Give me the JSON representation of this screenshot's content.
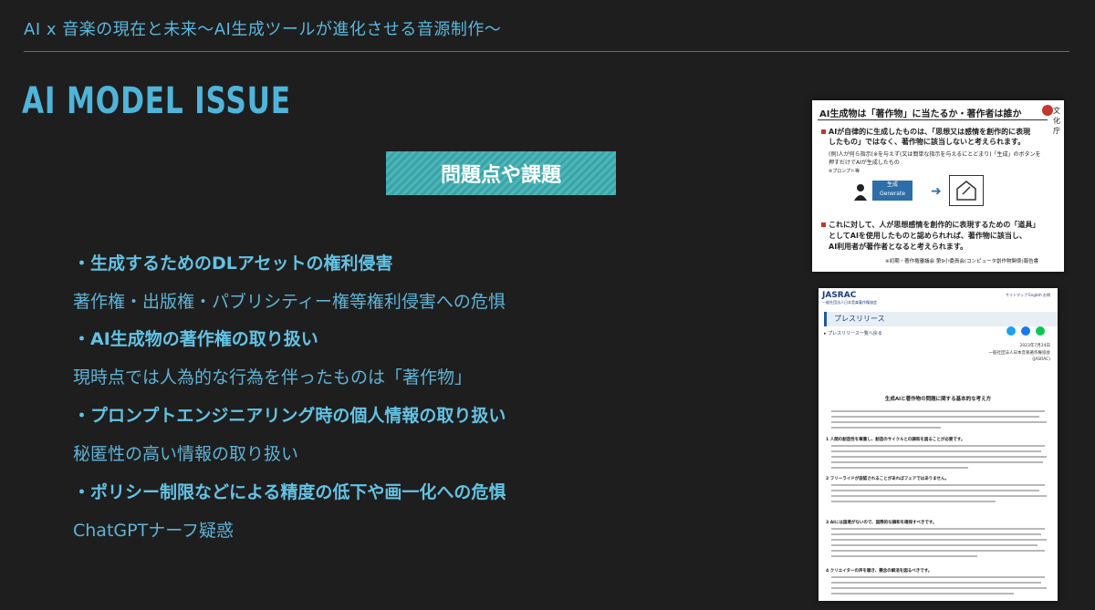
{
  "header": {
    "title": "AI x 音楽の現在と未来〜AI生成ツールが進化させる音源制作〜"
  },
  "slide": {
    "title": "AI MODEL ISSUE",
    "banner": "問題点や課題",
    "bullets": [
      "・生成するためのDLアセットの権利侵害",
      "・AI生成物の著作権の取り扱い",
      "・プロンプトエンジニアリング時の個人情報の取り扱い",
      "・ポリシー制限などによる精度の低下や画一化への危惧"
    ],
    "subs": [
      "著作権・出版権・パブリシティー権等権利侵害への危惧",
      "現時点では人為的な行為を伴ったものは「著作物」",
      "秘匿性の高い情報の取り扱い",
      "ChatGPTナーフ疑惑"
    ]
  },
  "image1": {
    "title": "AI生成物は「著作物」に当たるか・著作者は誰か",
    "logo_text": "文化庁",
    "p1": "AIが自律的に生成したものは、「思想又は感情を創作的に表現",
    "p2": "したもの」ではなく、著作物に該当しないと考えられます。",
    "p3": "(例)人が何ら指示(※を与えず(又は簡単な指示を与えるにとどまり)「生成」のボタンを",
    "p4": "押すだけでAIが生成したもの",
    "p5": "※プロンプト等",
    "gen_label": "生成\nGenerate",
    "p6": "これに対して、人が思想感情を創作的に表現するための「道具」",
    "p7": "としてAIを使用したものと認められれば、著作物に該当し、",
    "p8": "AI利用者が著作者となると考えられます。",
    "p9": "※初期・著作権審議会 第9小委員会(コンピュータ創作物関係)報告書"
  },
  "image2": {
    "logo": "JASRAC",
    "logo_sub": "一般社団法人日本音楽著作権協会",
    "nav": "サイトマップ  English  お問",
    "bar": "プレスリリース",
    "breadcrumb": "▸ プレスリリース一覧へ戻る",
    "date": "2023年7月24日",
    "org": "一般社団法人日本音楽著作権協会",
    "org2": "(JASRAC)",
    "heading": "生成AIと著作物の問題に関する基本的な考え方",
    "s1": "1 人間の創造性を尊重し、創造のサイクルとの調和を図ることが必要です。",
    "s2": "2 フリーライドが容認されることがあればフェアではありません。",
    "s3": "3 AIには国境がないので、国際的な調和を確保すべきです。",
    "s4": "4 クリエイターの声を聴き、懸念の解消を図るべきです。"
  }
}
